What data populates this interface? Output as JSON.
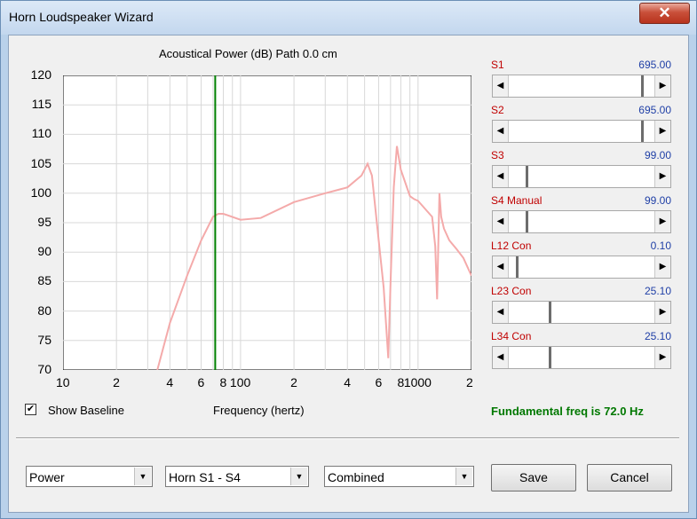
{
  "window": {
    "title": "Horn Loudspeaker Wizard",
    "close_glyph": "✕"
  },
  "plot": {
    "title": "Acoustical Power (dB)   Path 0.0 cm",
    "xlabel": "Frequency (hertz)",
    "y_ticks": [
      "120",
      "115",
      "110",
      "105",
      "100",
      "95",
      "90",
      "85",
      "80",
      "75",
      "70"
    ],
    "x_ticks": [
      "10",
      "2",
      "4",
      "6",
      "8",
      "100",
      "2",
      "4",
      "6",
      "8",
      "1000",
      "2"
    ],
    "marker_color": "#008000",
    "curve_color": "#f4aaaa"
  },
  "chart_data": {
    "type": "line",
    "title": "Acoustical Power (dB)   Path 0.0 cm",
    "xlabel": "Frequency (hertz)",
    "ylabel": "",
    "x_scale": "log",
    "xlim": [
      10,
      2000
    ],
    "ylim": [
      70,
      120
    ],
    "grid": true,
    "marker_frequency": 72.0,
    "series": [
      {
        "x": [
          34,
          40,
          50,
          60,
          70,
          75,
          80,
          100,
          130,
          200,
          300,
          400,
          480,
          520,
          550,
          600,
          640,
          680,
          700,
          730,
          760,
          780,
          800,
          900,
          950,
          1000,
          1200,
          1250,
          1280,
          1320,
          1350,
          1400,
          1500,
          1650,
          1800,
          2000
        ],
        "y": [
          70,
          78,
          86,
          92,
          96,
          96.5,
          96.5,
          95.5,
          95.8,
          98.5,
          100,
          101,
          103,
          105,
          103,
          92,
          84,
          72,
          85,
          101,
          108,
          106,
          104,
          99.5,
          99,
          98.7,
          96,
          91,
          82,
          100,
          96,
          94,
          92,
          90.5,
          89,
          86
        ]
      }
    ]
  },
  "show_baseline": {
    "label": "Show Baseline",
    "checked": true,
    "check_glyph": "✔"
  },
  "sliders": [
    {
      "label": "S1",
      "value": "695.00",
      "pos": 0.92
    },
    {
      "label": "S2",
      "value": "695.00",
      "pos": 0.92
    },
    {
      "label": "S3",
      "value": "99.00",
      "pos": 0.12
    },
    {
      "label": "S4  Manual",
      "value": "99.00",
      "pos": 0.12
    },
    {
      "label": "L12  Con",
      "value": "0.10",
      "pos": 0.05
    },
    {
      "label": "L23  Con",
      "value": "25.10",
      "pos": 0.28
    },
    {
      "label": "L34  Con",
      "value": "25.10",
      "pos": 0.28
    }
  ],
  "fundamental_text": "Fundamental freq is 72.0 Hz",
  "fundamental_color": "#007800",
  "combos": [
    {
      "value": "Power"
    },
    {
      "value": "Horn S1 - S4"
    },
    {
      "value": "Combined"
    }
  ],
  "buttons": {
    "save": "Save",
    "cancel": "Cancel"
  }
}
